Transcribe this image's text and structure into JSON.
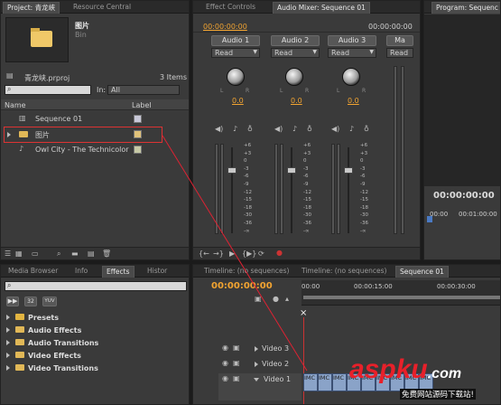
{
  "project": {
    "tabs": [
      "Project: 青龙峡",
      "Resource Central"
    ],
    "bin_name": "图片",
    "bin_type": "Bin",
    "file_name": "青龙峡.prproj",
    "item_count": "3 Items",
    "in_label": "In:",
    "in_value": "All",
    "col_name": "Name",
    "col_label": "Label",
    "items": [
      {
        "name": "Sequence 01",
        "color": "#c8c8d8"
      },
      {
        "name": "图片",
        "color": "#e0c27a"
      },
      {
        "name": "Owl City - The Technicolor",
        "color": "#c7c9a6"
      }
    ]
  },
  "mixer": {
    "tabs": [
      "Effect Controls",
      "Audio Mixer: Sequence 01"
    ],
    "time_left": "00:00:00:00",
    "time_right": "00:00:00:00",
    "channels": [
      {
        "name": "Audio 1",
        "mode": "Read",
        "value": "0.0"
      },
      {
        "name": "Audio 2",
        "mode": "Read",
        "value": "0.0"
      },
      {
        "name": "Audio 3",
        "mode": "Read",
        "value": "0.0"
      },
      {
        "name": "Ma",
        "mode": "Read",
        "value": ""
      }
    ],
    "knob_l": "L",
    "knob_r": "R",
    "scale": [
      "+6",
      "+3",
      "0",
      "-3",
      "-6",
      "-9",
      "-12",
      "-15",
      "-18",
      "-30",
      "-36",
      "-∞"
    ]
  },
  "program": {
    "tab": "Program: Sequenc",
    "timecode": "00:00:00:00",
    "ruler_start": "00:00",
    "ruler_mid": "00:01:00:00"
  },
  "effects": {
    "tabs": [
      "Media Browser",
      "Info",
      "Effects",
      "Histor"
    ],
    "tool_labels": [
      "32",
      "YUV"
    ],
    "items": [
      "Presets",
      "Audio Effects",
      "Audio Transitions",
      "Video Effects",
      "Video Transitions"
    ]
  },
  "timeline": {
    "tabs": [
      "Timeline: (no sequences)",
      "Timeline: (no sequences)",
      "Sequence 01"
    ],
    "timecode": "00:00:00:00",
    "ruler": [
      "00:00",
      "00:00:15:00",
      "00:00:30:00"
    ],
    "tracks": [
      "Video 3",
      "Video 2",
      "Video 1"
    ],
    "clip_label": "IMC"
  },
  "watermark": {
    "brand": "aspku",
    "domain": ".com",
    "subtitle": "免费网站源码下载站!"
  }
}
